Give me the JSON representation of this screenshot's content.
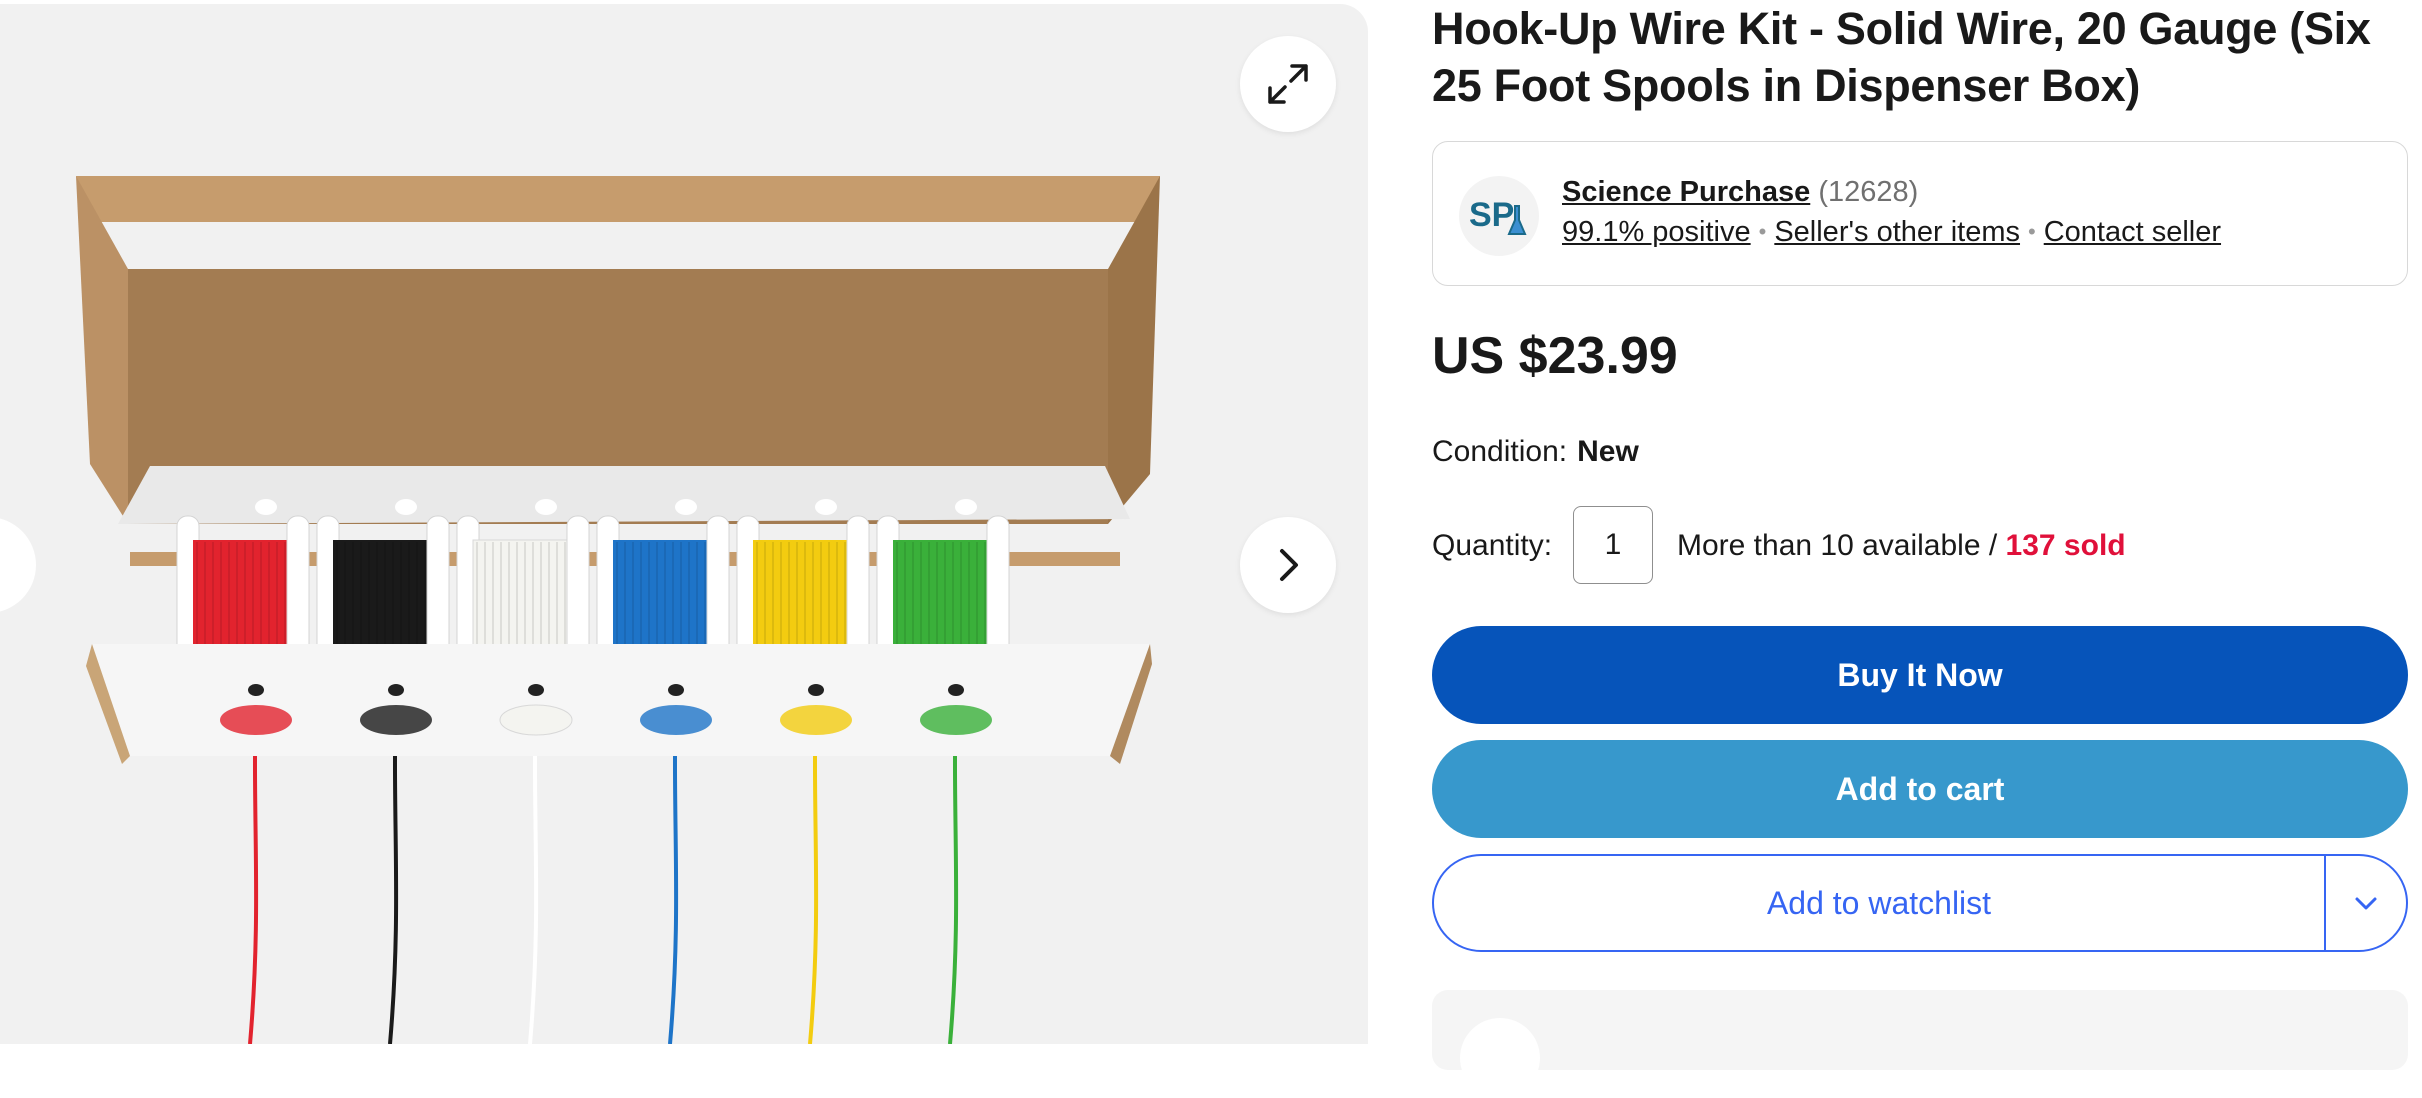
{
  "product": {
    "title": "Hook-Up Wire Kit - Solid Wire, 20 Gauge (Six 25 Foot Spools in Dispenser Box)",
    "image_alt": "Cardboard dispenser box with six wire spools"
  },
  "gallery": {
    "expand_icon": "expand-icon",
    "next_icon": "chevron-right-icon",
    "spool_colors": [
      "#e2232e",
      "#1a1a1a",
      "#f4f4f0",
      "#1e74c8",
      "#f3cc10",
      "#3ab03a"
    ]
  },
  "seller": {
    "logo_text": "SP",
    "name": "Science Purchase",
    "feedback_count": "(12628)",
    "positive": "99.1% positive",
    "other_items": "Seller's other items",
    "contact": "Contact seller"
  },
  "price": "US $23.99",
  "condition": {
    "label": "Condition:",
    "value": "New"
  },
  "quantity": {
    "label": "Quantity:",
    "value": "1",
    "available": "More than 10 available / ",
    "sold": "137 sold"
  },
  "actions": {
    "buy_now": "Buy It Now",
    "add_to_cart": "Add to cart",
    "add_to_watchlist": "Add to watchlist"
  },
  "colors": {
    "primary": "#0654ba",
    "secondary": "#3798cc",
    "link": "#3665f3",
    "sold": "#e0103a"
  }
}
